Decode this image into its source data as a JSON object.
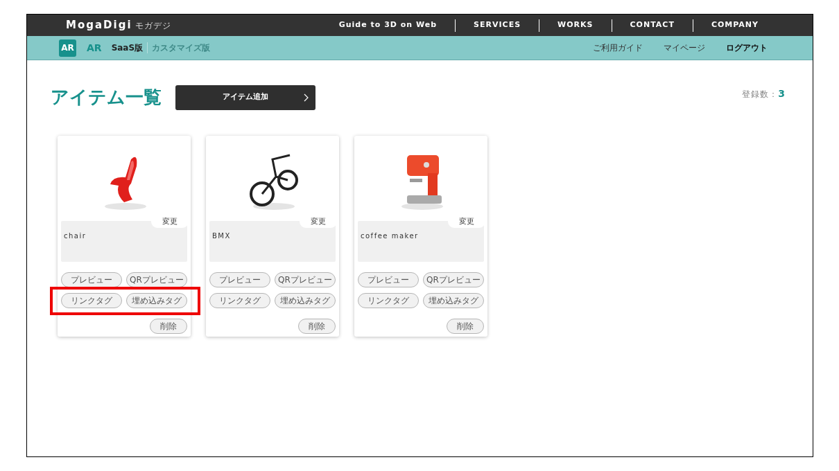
{
  "header": {
    "logo": "MogaDigi",
    "logo_kana": "モガデジ",
    "nav": [
      "Guide to 3D on Web",
      "SERVICES",
      "WORKS",
      "CONTACT",
      "COMPANY"
    ]
  },
  "subbar": {
    "badge": "AR",
    "product": "AR",
    "editions": [
      {
        "label": "SaaS版",
        "selected": true
      },
      {
        "label": "カスタマイズ版",
        "selected": false
      }
    ],
    "links": [
      {
        "label": "ご利用ガイド",
        "emphasized": false
      },
      {
        "label": "マイページ",
        "emphasized": false
      },
      {
        "label": "ログアウト",
        "emphasized": true
      }
    ]
  },
  "page": {
    "title": "アイテム一覧",
    "add_button": "アイテム追加",
    "count_label": "登録数：",
    "count": "3"
  },
  "items": [
    {
      "name": "chair",
      "change": "変更",
      "buttons": [
        "プレビュー",
        "QRプレビュー",
        "リンクタグ",
        "埋め込みタグ"
      ],
      "delete": "削除",
      "tags_highlighted": true
    },
    {
      "name": "BMX",
      "change": "変更",
      "buttons": [
        "プレビュー",
        "QRプレビュー",
        "リンクタグ",
        "埋め込みタグ"
      ],
      "delete": "削除",
      "tags_highlighted": false
    },
    {
      "name": "coffee maker",
      "change": "変更",
      "buttons": [
        "プレビュー",
        "QRプレビュー",
        "リンクタグ",
        "埋め込みタグ"
      ],
      "delete": "削除",
      "tags_highlighted": false
    }
  ]
}
